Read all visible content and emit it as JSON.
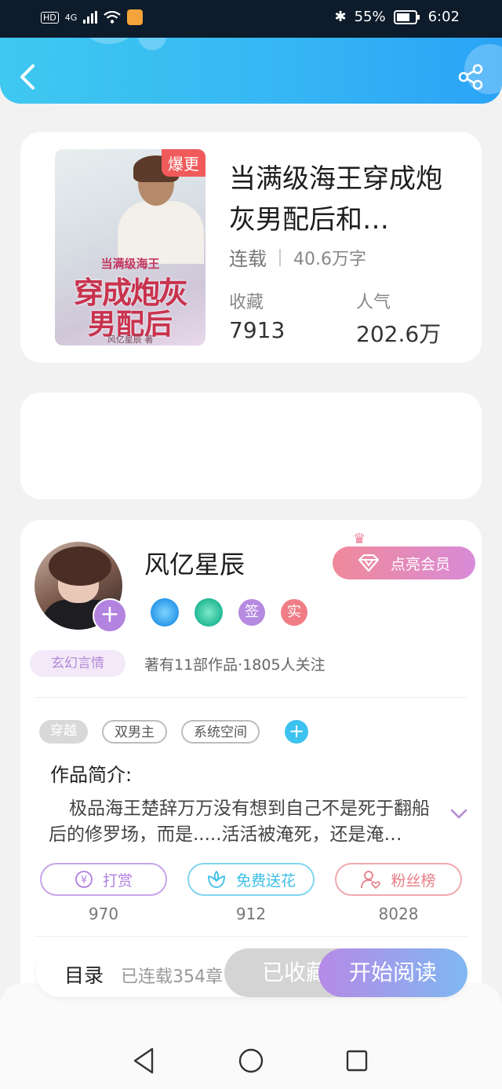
{
  "status_bar": {
    "hd": "HD",
    "network": "4G",
    "battery": "55%",
    "time": "6:02"
  },
  "header": {
    "back_icon": "chevron-left-icon",
    "share_icon": "share-icon"
  },
  "book": {
    "cover_badge": "爆更",
    "cover_subtitle": "当满级海王",
    "cover_title_line1": "穿成炮灰",
    "cover_title_line2": "男配后",
    "cover_author": "风亿星辰 著",
    "title": "当满级海王穿成炮灰男配后和…",
    "status": "连载",
    "word_count": "40.6万字",
    "favorites_label": "收藏",
    "favorites_value": "7913",
    "popularity_label": "人气",
    "popularity_value": "202.6万"
  },
  "author": {
    "name": "风亿星辰",
    "vip_button": "点亮会员",
    "badge_sign": "签",
    "badge_real": "实",
    "genre_tag": "玄幻言情",
    "summary": "著有11部作品·1805人关注"
  },
  "tags": [
    "穿越",
    "双男主",
    "系统空间"
  ],
  "intro": {
    "title": "作品简介:",
    "text": "极品海王楚辞万万没有想到自己不是死于翻船后的修罗场，而是.....活活被淹死，还是淹…"
  },
  "actions": [
    {
      "label": "打赏",
      "count": "970",
      "color": "#b07fe0"
    },
    {
      "label": "免费送花",
      "count": "912",
      "color": "#3cbfe6"
    },
    {
      "label": "粉丝榜",
      "count": "8028",
      "color": "#e87c86"
    }
  ],
  "bottom_bar": {
    "toc_label": "目录",
    "toc_status": "已连载354章",
    "collected_button": "已收藏",
    "read_button": "开始阅读"
  },
  "colors": {
    "header_gradient_start": "#3fc8f0",
    "header_gradient_end": "#2aa3f6",
    "vip_gradient_start": "#f08a9a",
    "read_gradient_start": "#b58ae6",
    "read_gradient_end": "#7fb8f2"
  }
}
